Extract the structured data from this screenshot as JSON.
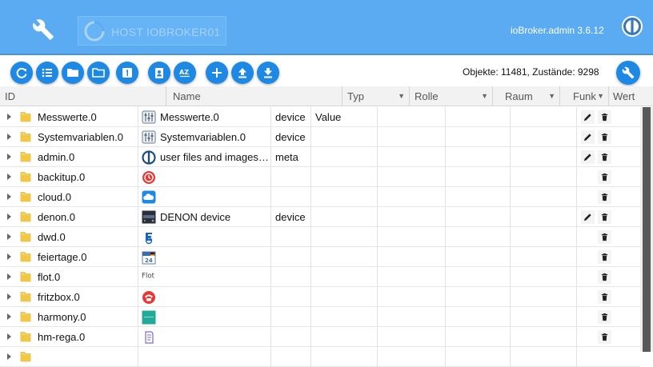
{
  "header": {
    "host_label": "HOST IOBROKER01",
    "app_version": "ioBroker.admin 3.6.12"
  },
  "toolbar": {
    "buttons": [
      "refresh-icon",
      "list-icon",
      "folder-icon",
      "folder-open-icon",
      "number-one-icon",
      "clipboard-user-icon",
      "sort-az-icon",
      "plus-icon",
      "upload-icon",
      "download-icon"
    ],
    "counts": "Objekte: 11481, Zustände: 9298"
  },
  "table": {
    "columns": {
      "id": "ID",
      "name": "Name",
      "typ": "Typ",
      "rolle": "Rolle",
      "raum": "Raum",
      "funk": "Funk",
      "wert": "Wert"
    },
    "rows": [
      {
        "id": "Messwerte.0",
        "icon": "sliders-icon",
        "name": "Messwerte.0",
        "type": "device",
        "role": "Value",
        "edit": true
      },
      {
        "id": "Systemvariablen.0",
        "icon": "sliders-icon",
        "name": "Systemvariablen.0",
        "type": "device",
        "role": "",
        "edit": true
      },
      {
        "id": "admin.0",
        "icon": "iobroker-logo-icon",
        "name": "user files and images for...",
        "type": "meta",
        "role": "",
        "edit": true
      },
      {
        "id": "backitup.0",
        "icon": "backup-clock-icon",
        "name": "",
        "type": "",
        "role": "",
        "edit": false
      },
      {
        "id": "cloud.0",
        "icon": "cloud-icon",
        "name": "",
        "type": "",
        "role": "",
        "edit": false
      },
      {
        "id": "denon.0",
        "icon": "denon-receiver-icon",
        "name": "DENON device",
        "type": "device",
        "role": "",
        "edit": true
      },
      {
        "id": "dwd.0",
        "icon": "weather-warning-icon",
        "name": "",
        "type": "",
        "role": "",
        "edit": false
      },
      {
        "id": "feiertage.0",
        "icon": "calendar-icon",
        "name": "",
        "type": "",
        "role": "",
        "edit": false
      },
      {
        "id": "flot.0",
        "icon": "flot-logo-icon",
        "name": "",
        "type": "",
        "role": "",
        "edit": false
      },
      {
        "id": "fritzbox.0",
        "icon": "telephone-icon",
        "name": "",
        "type": "",
        "role": "",
        "edit": false
      },
      {
        "id": "harmony.0",
        "icon": "harmony-remote-icon",
        "name": "",
        "type": "",
        "role": "",
        "edit": false
      },
      {
        "id": "hm-rega.0",
        "icon": "script-icon",
        "name": "",
        "type": "",
        "role": "",
        "edit": false
      },
      {
        "id": "",
        "icon": "",
        "name": "",
        "type": "",
        "role": "",
        "edit": false
      }
    ]
  },
  "colors": {
    "header": "#5aabf1",
    "button": "#1e88e5",
    "folder": "#f2c744",
    "scroll_thumb": "#585858"
  }
}
